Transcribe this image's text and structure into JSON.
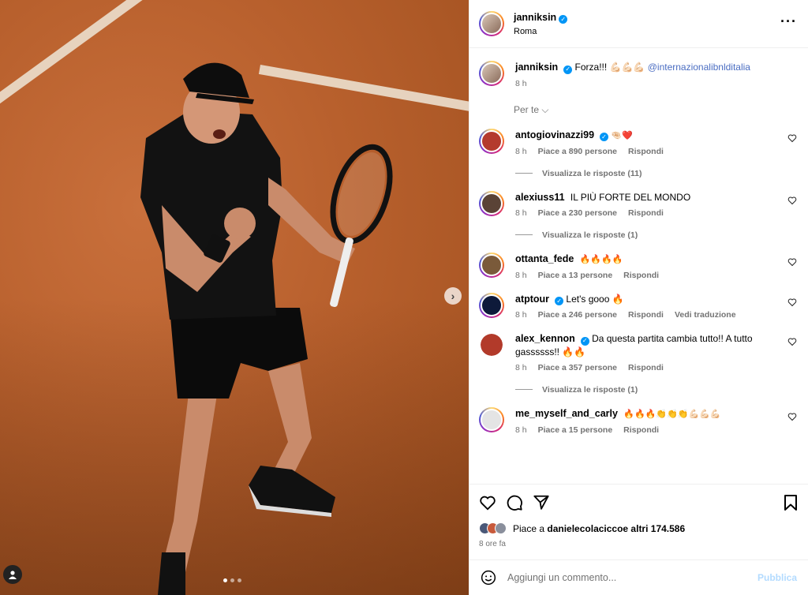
{
  "post": {
    "username": "janniksin",
    "location": "Roma",
    "caption": {
      "username": "janniksin",
      "text": "Forza!!! 💪🏻💪🏻💪🏻",
      "mention": "@internazionalibnlditalia",
      "time": "8 h"
    },
    "sort_label": "Per te"
  },
  "comments": [
    {
      "username": "antogiovinazzi99",
      "verified": true,
      "text": "🤏🏻❤️",
      "time": "8 h",
      "likes": "Piace a 890 persone",
      "reply": "Rispondi",
      "replies": "Visualizza le risposte (11)"
    },
    {
      "username": "alexiuss11",
      "verified": false,
      "text": "IL PIÙ FORTE DEL MONDO",
      "time": "8 h",
      "likes": "Piace a 230 persone",
      "reply": "Rispondi",
      "replies": "Visualizza le risposte (1)"
    },
    {
      "username": "ottanta_fede",
      "verified": false,
      "text": "🔥🔥🔥🔥",
      "time": "8 h",
      "likes": "Piace a 13 persone",
      "reply": "Rispondi",
      "replies": ""
    },
    {
      "username": "atptour",
      "verified": true,
      "text": "Let's gooo 🔥",
      "time": "8 h",
      "likes": "Piace a 246 persone",
      "reply": "Rispondi",
      "translate": "Vedi traduzione",
      "replies": ""
    },
    {
      "username": "alex_kennon",
      "verified": true,
      "text": "Da questa partita cambia tutto!! A tutto gassssss!! 🔥🔥",
      "time": "8 h",
      "likes": "Piace a 357 persone",
      "reply": "Rispondi",
      "replies": "Visualizza le risposte (1)"
    },
    {
      "username": "me_myself_and_carly",
      "verified": false,
      "text": "🔥🔥🔥👏👏👏💪🏻💪🏻💪🏻",
      "time": "8 h",
      "likes": "Piace a 15 persone",
      "reply": "Rispondi",
      "replies": ""
    }
  ],
  "likes": {
    "prefix": "Piace a ",
    "user": "danielecolacicco",
    "suffix": " e altri 174.586",
    "time_ago": "8 ore fa"
  },
  "add_comment": {
    "placeholder": "Aggiungi un commento...",
    "publish_label": "Pubblica"
  },
  "colors": {
    "verified": "#0095f6",
    "mention": "#4a6dc2",
    "secondary_text": "#737373",
    "clay": "#b8602d"
  },
  "icons": [
    "verified-icon",
    "more-icon",
    "heart-icon",
    "comment-icon",
    "share-icon",
    "bookmark-icon",
    "emoji-icon",
    "chevron-right-icon",
    "user-tag-icon"
  ]
}
